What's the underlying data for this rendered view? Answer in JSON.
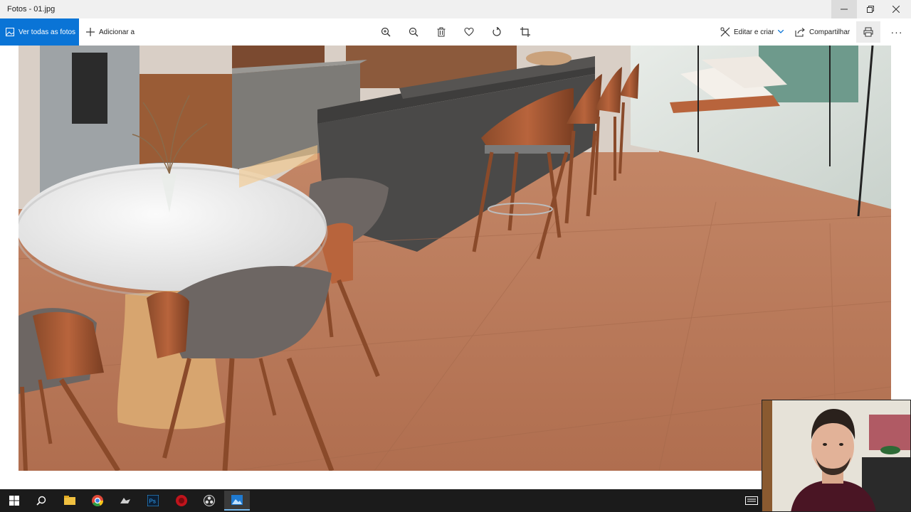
{
  "window": {
    "title": "Fotos - 01.jpg",
    "controls": {
      "minimize_icon": "minimize-icon",
      "maximize_icon": "restore-icon",
      "close_icon": "close-icon"
    }
  },
  "toolbar": {
    "see_all_label": "Ver todas as fotos",
    "add_to_label": "Adicionar a",
    "edit_create_label": "Editar e criar",
    "share_label": "Compartilhar",
    "tools": [
      "zoom-in-icon",
      "zoom-out-icon",
      "delete-icon",
      "favorite-icon",
      "rotate-icon",
      "crop-icon"
    ],
    "accent_color": "#0a74d6"
  },
  "photo": {
    "filename": "01.jpg"
  },
  "taskbar": {
    "items": [
      "start-icon",
      "search-icon",
      "file-explorer-icon",
      "chrome-icon",
      "app-icon",
      "photoshop-icon",
      "red-app-icon",
      "obs-icon",
      "photos-icon"
    ],
    "active_item": "photos-icon"
  },
  "webcam": {
    "visible": true
  }
}
